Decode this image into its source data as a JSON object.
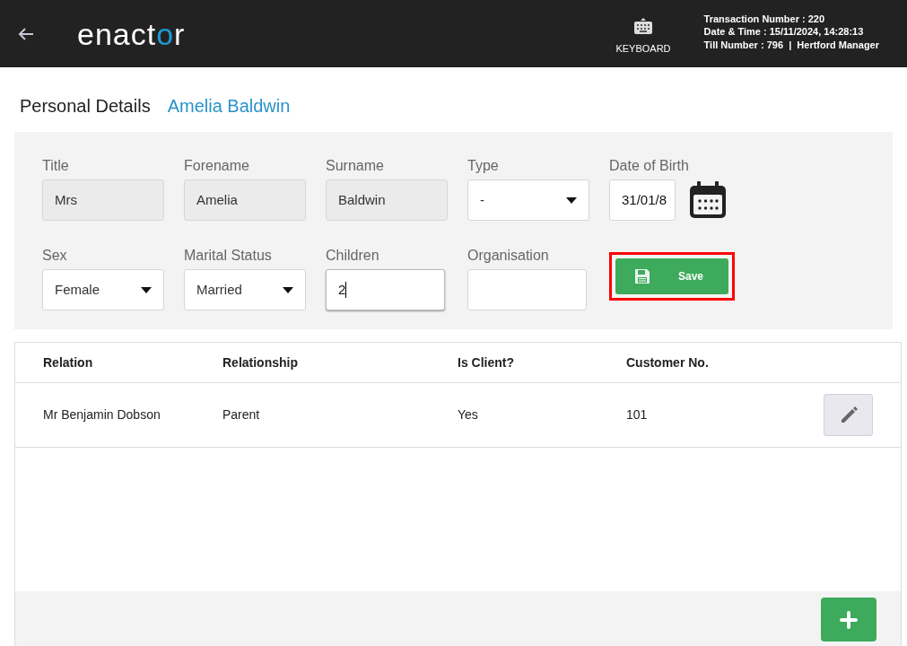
{
  "header": {
    "logo": [
      {
        "text": "enact",
        "accent": false
      },
      {
        "text": "o",
        "accent": true
      },
      {
        "text": "r",
        "accent": false
      }
    ],
    "keyboard_label": "KEYBOARD",
    "info": [
      "Transaction Number : 220",
      "Date & Time : 15/11/2024, 14:28:13",
      "Till Number : 796  |  Hertford Manager"
    ]
  },
  "page": {
    "title": "Personal Details",
    "customer": "Amelia Baldwin"
  },
  "form": {
    "rows": [
      [
        {
          "label": "Title",
          "kind": "readonly",
          "value": "Mrs"
        },
        {
          "label": "Forename",
          "kind": "readonly",
          "value": "Amelia"
        },
        {
          "label": "Surname",
          "kind": "readonly",
          "value": "Baldwin"
        },
        {
          "label": "Type",
          "kind": "select",
          "value": "-"
        },
        {
          "label": "Date of Birth",
          "kind": "date",
          "value": "31/01/8"
        }
      ],
      [
        {
          "label": "Sex",
          "kind": "select",
          "value": "Female"
        },
        {
          "label": "Marital Status",
          "kind": "select",
          "value": "Married"
        },
        {
          "label": "Children",
          "kind": "text",
          "value": "2",
          "focused": true
        },
        {
          "label": "Organisation",
          "kind": "text",
          "focused": false
        },
        {
          "kind": "save",
          "label_text": "Save",
          "highlighted": true
        }
      ]
    ]
  },
  "table": {
    "columns": [
      "Relation",
      "Relationship",
      "Is Client?",
      "Customer No."
    ],
    "rows": [
      {
        "cells": [
          "Mr Benjamin Dobson",
          "Parent",
          "Yes",
          "101"
        ]
      }
    ]
  }
}
